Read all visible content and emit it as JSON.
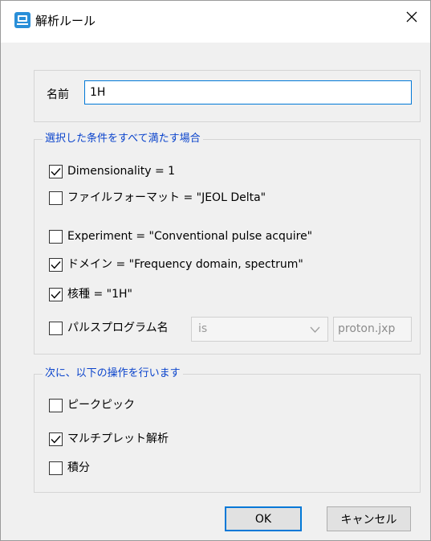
{
  "window": {
    "title": "解析ルール",
    "close_glyph": "✕"
  },
  "name_field": {
    "label": "名前",
    "value": "1H"
  },
  "conditions": {
    "title": "選択した条件をすべて満たす場合",
    "items": [
      {
        "label": "Dimensionality = 1",
        "checked": true
      },
      {
        "label": "ファイルフォーマット = \"JEOL Delta\"",
        "checked": false
      },
      {
        "label": "Experiment = \"Conventional pulse acquire\"",
        "checked": false
      },
      {
        "label": "ドメイン = \"Frequency domain, spectrum\"",
        "checked": true
      },
      {
        "label": "核種 = \"1H\"",
        "checked": true
      },
      {
        "label": "パルスプログラム名",
        "checked": false
      }
    ],
    "pulse_operator": "is",
    "pulse_value": "proton.jxp"
  },
  "actions": {
    "title": "次に、以下の操作を行います",
    "items": [
      {
        "label": "ピークピック",
        "checked": false
      },
      {
        "label": "マルチプレット解析",
        "checked": true
      },
      {
        "label": "積分",
        "checked": false
      }
    ]
  },
  "buttons": {
    "ok": "OK",
    "cancel": "キャンセル"
  },
  "colors": {
    "accent": "#0078d7",
    "group_title": "#0b44cc",
    "icon": "#2a8fd8"
  }
}
